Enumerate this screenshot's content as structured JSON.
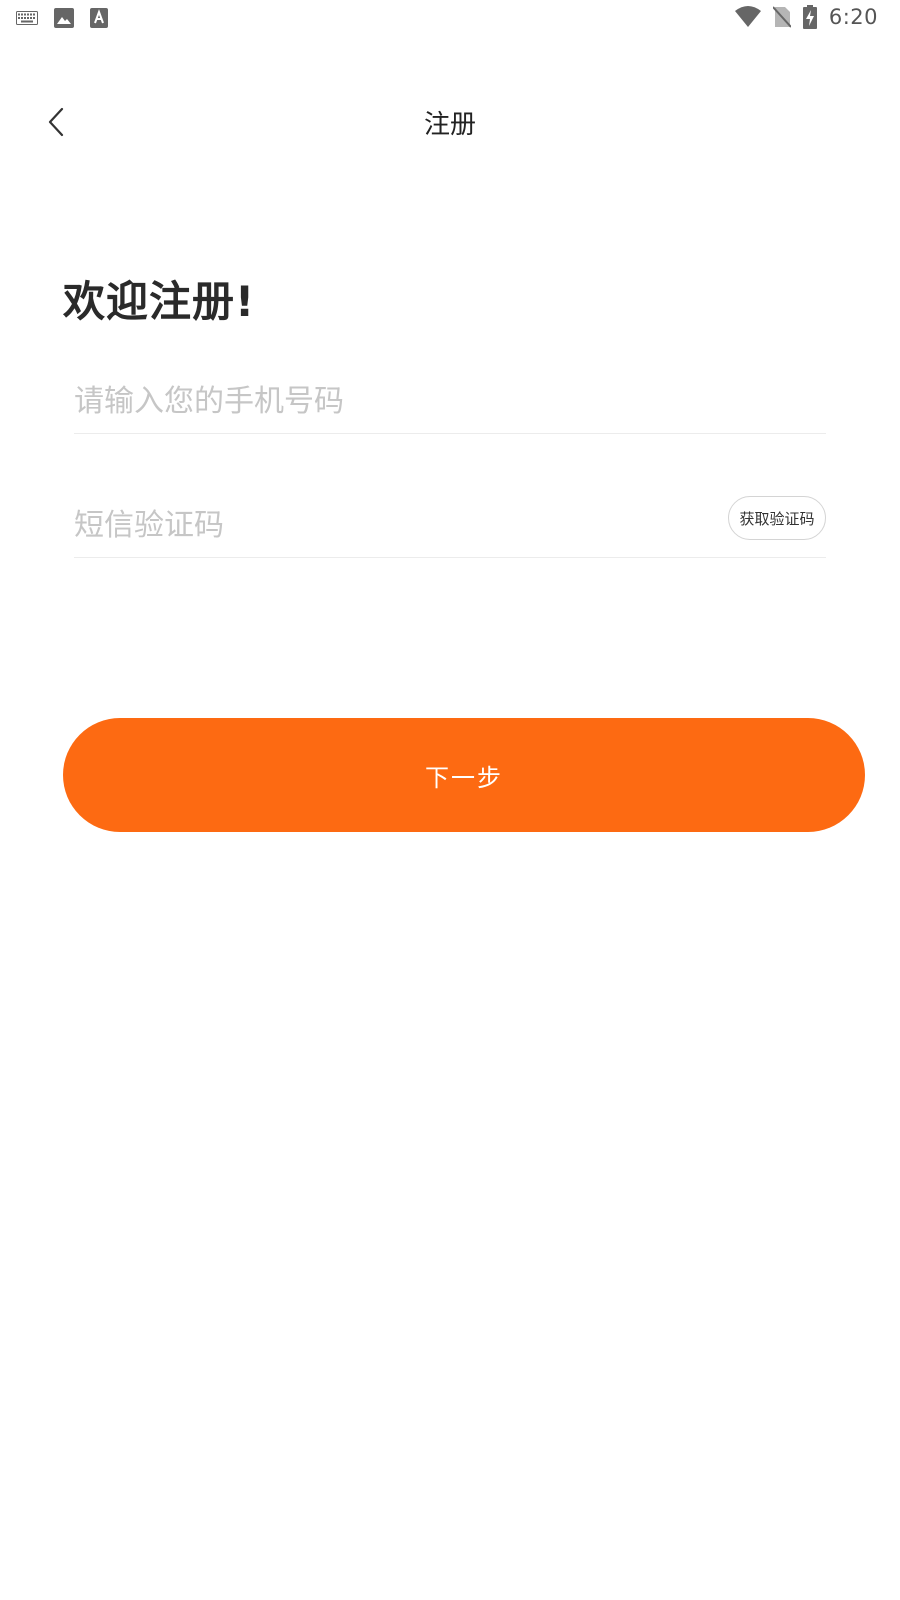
{
  "status_bar": {
    "time": "6:20",
    "left_icons": [
      "keyboard-icon",
      "image-icon",
      "font-download-icon"
    ],
    "right_icons": [
      "wifi-icon",
      "no-sim-icon",
      "battery-charging-icon"
    ]
  },
  "header": {
    "back_icon": "chevron-left-icon",
    "title": "注册"
  },
  "main": {
    "welcome": "欢迎注册!",
    "phone_input": {
      "value": "",
      "placeholder": "请输入您的手机号码"
    },
    "code_input": {
      "value": "",
      "placeholder": "短信验证码"
    },
    "get_code_label": "获取验证码",
    "next_label": "下一步"
  },
  "colors": {
    "accent": "#fd6a12",
    "placeholder": "#c6c6c6",
    "divider": "#ececec"
  }
}
